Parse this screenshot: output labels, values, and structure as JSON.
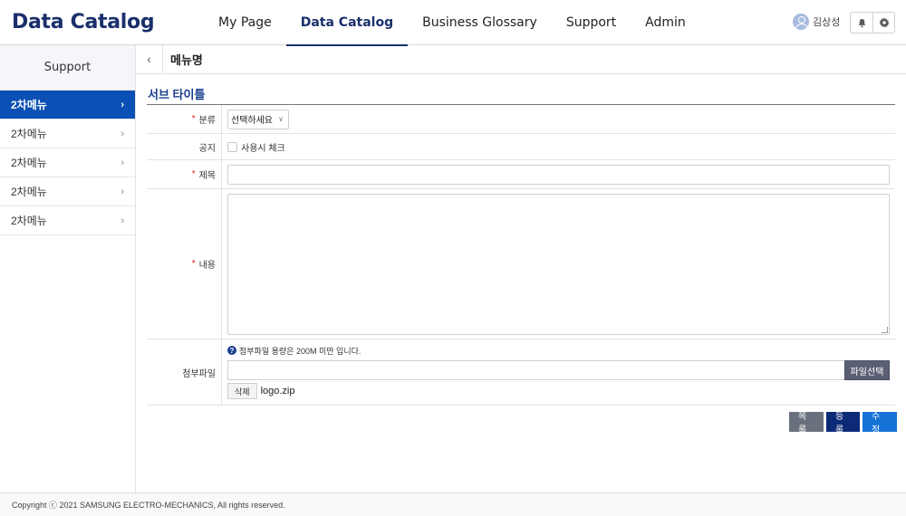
{
  "header": {
    "logo": "Data Catalog",
    "nav": [
      {
        "label": "My Page",
        "active": false
      },
      {
        "label": "Data Catalog",
        "active": true
      },
      {
        "label": "Business Glossary",
        "active": false
      },
      {
        "label": "Support",
        "active": false
      },
      {
        "label": "Admin",
        "active": false
      }
    ],
    "user_name": "김상성",
    "icons": [
      "bell-icon",
      "gear-icon"
    ]
  },
  "sidebar": {
    "title": "Support",
    "items": [
      {
        "label": "2차메뉴",
        "active": true
      },
      {
        "label": "2차메뉴",
        "active": false
      },
      {
        "label": "2차메뉴",
        "active": false
      },
      {
        "label": "2차메뉴",
        "active": false
      },
      {
        "label": "2차메뉴",
        "active": false
      }
    ]
  },
  "subheader": {
    "menu_name": "메뉴명"
  },
  "form": {
    "subtitle": "서브 타이틀",
    "category": {
      "label": "분류",
      "required": true,
      "selected": "선택하세요"
    },
    "notice": {
      "label": "공지",
      "checkbox_label": "사용시 체크",
      "checked": false
    },
    "title": {
      "label": "제목",
      "required": true,
      "value": ""
    },
    "content": {
      "label": "내용",
      "required": true,
      "value": ""
    },
    "attachment": {
      "label": "첨부파일",
      "notice": "첨부파일 용량은 200M 미만 입니다.",
      "select_button": "파일선택",
      "delete_button": "삭제",
      "file_name": "logo.zip"
    }
  },
  "actions": {
    "list": "목록",
    "register": "등록",
    "edit": "수정"
  },
  "footer": {
    "copyright": "Copyright ⓒ 2021 SAMSUNG ELECTRO-MECHANICS, All rights reserved."
  },
  "colors": {
    "brand": "#1a2f6b",
    "sidebar_active": "#0b50b5",
    "required": "#d9262c",
    "btn_list": "#6b707e",
    "btn_register": "#0d2a78",
    "btn_edit": "#1672d6"
  }
}
